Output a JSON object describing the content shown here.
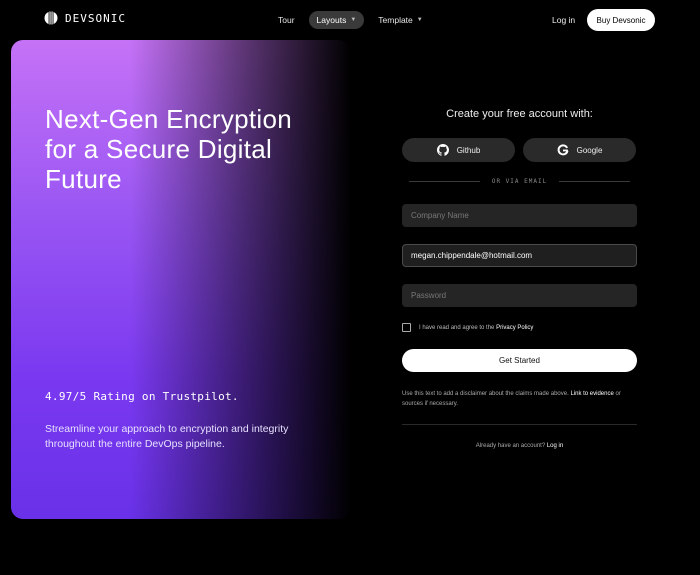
{
  "nav": {
    "brand": "DEVSONIC",
    "links": [
      {
        "label": "Tour"
      },
      {
        "label": "Layouts"
      },
      {
        "label": "Template"
      }
    ],
    "login_label": "Log in",
    "buy_label": "Buy Devsonic"
  },
  "hero": {
    "title": "Next-Gen Encryption for a Secure Digital Future",
    "rating": "4.97/5 Rating on Trustpilot.",
    "description": "Streamline your approach to encryption and integrity throughout the entire DevOps pipeline."
  },
  "form": {
    "title": "Create your free account with:",
    "github_label": "Github",
    "google_label": "Google",
    "divider_text": "OR VIA EMAIL",
    "company_placeholder": "Company Name",
    "email_value": "megan.chippendale@hotmail.com",
    "password_placeholder": "Password",
    "agree_text": "I have read and agree to the",
    "agree_link": "Privacy Policy",
    "submit_label": "Get Started",
    "disclaimer_text": "Use this text to add a disclaimer about the claims made above.",
    "disclaimer_link": "Link to evidence",
    "disclaimer_suffix": "or sources if necessary.",
    "already_text": "Already have an account?",
    "already_link": "Log in"
  },
  "icons": {
    "brand": "devsonic-logo-icon",
    "github": "github-icon",
    "google": "google-icon",
    "caret": "chevron-down-icon"
  },
  "colors": {
    "background": "#000000",
    "hero_gradient_start": "#c572f6",
    "hero_gradient_end": "#6931e8",
    "button_light": "#ffffff",
    "input_bg": "#252525"
  }
}
